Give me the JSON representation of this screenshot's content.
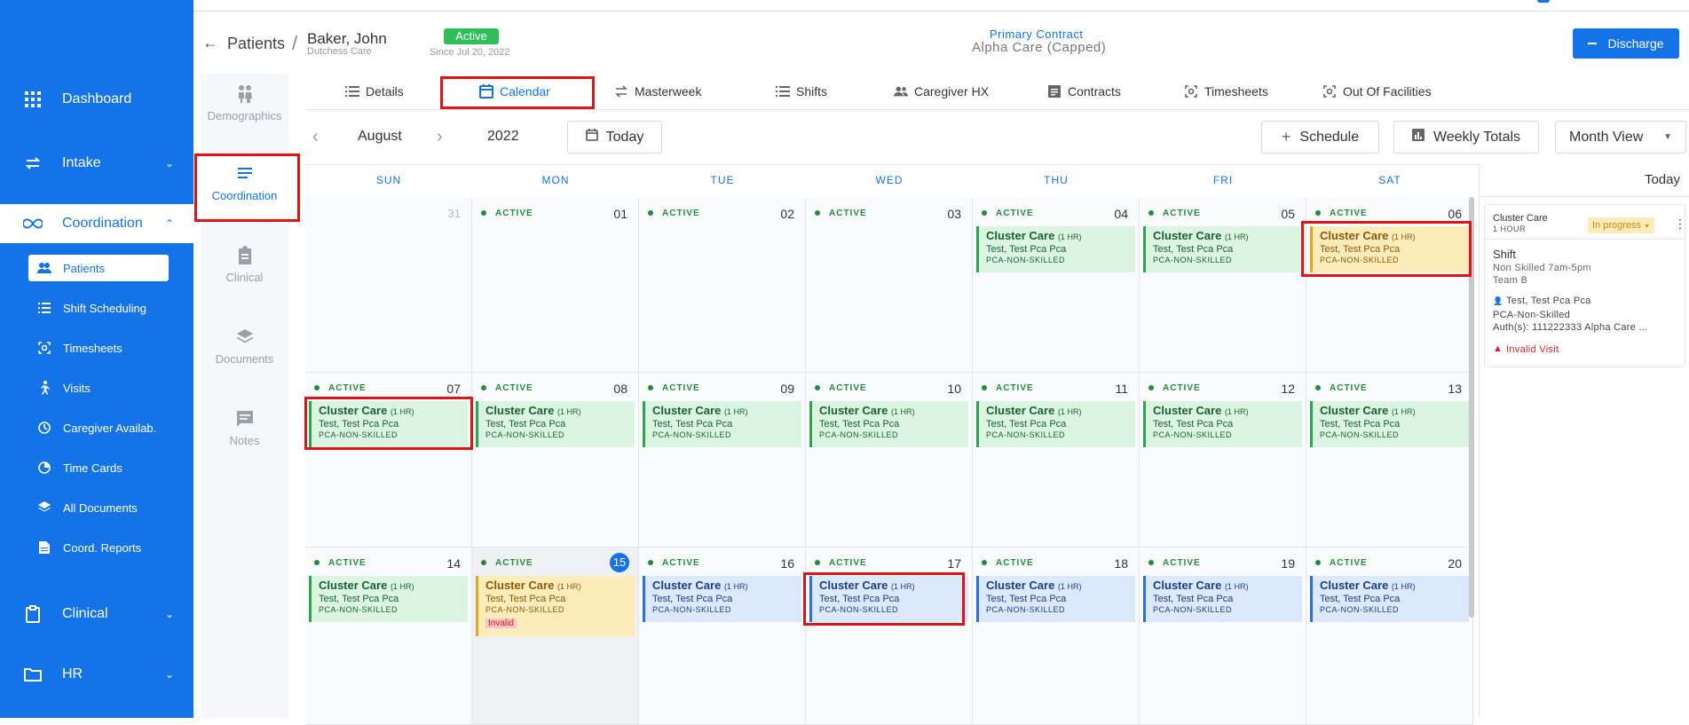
{
  "sidebar": {
    "dashboard": "Dashboard",
    "intake": "Intake",
    "coordination": "Coordination",
    "sub": [
      "Patients",
      "Shift Scheduling",
      "Timesheets",
      "Visits",
      "Caregiver Availab.",
      "Time Cards",
      "All Documents",
      "Coord. Reports"
    ],
    "clinical": "Clinical",
    "hr": "HR"
  },
  "header": {
    "breadcrumb_root": "Patients",
    "separator": "/",
    "patient_name": "Baker, John",
    "patient_sub": "Dutchess Care",
    "status": "Active",
    "since": "Since Jul 20, 2022",
    "contract_label": "Primary Contract",
    "contract_value": "Alpha Care (Capped)",
    "discharge": "Discharge"
  },
  "left_tabs": [
    "Demographics",
    "Coordination",
    "Clinical",
    "Documents",
    "Notes"
  ],
  "tabs": [
    "Details",
    "Calendar",
    "Masterweek",
    "Shifts",
    "Caregiver HX",
    "Contracts",
    "Timesheets",
    "Out Of Facilities"
  ],
  "toolbar": {
    "month": "August",
    "year": "2022",
    "today": "Today",
    "schedule": "Schedule",
    "weekly_totals": "Weekly Totals",
    "view": "Month View"
  },
  "days": [
    "SUN",
    "MON",
    "TUE",
    "WED",
    "THU",
    "FRI",
    "SAT"
  ],
  "status_label": "ACTIVE",
  "event": {
    "title": "Cluster Care",
    "dur": "(1 HR)",
    "person": "Test, Test Pca Pca",
    "role": "PCA-NON-SKILLED",
    "invalid": "Invalid"
  },
  "weeks": [
    [
      {
        "d": "31",
        "muted": true
      },
      {
        "d": "01",
        "s": true
      },
      {
        "d": "02",
        "s": true
      },
      {
        "d": "03",
        "s": true
      },
      {
        "d": "04",
        "s": true,
        "e": "g"
      },
      {
        "d": "05",
        "s": true,
        "e": "g"
      },
      {
        "d": "06",
        "s": true,
        "e": "y"
      }
    ],
    [
      {
        "d": "07",
        "s": true,
        "e": "g"
      },
      {
        "d": "08",
        "s": true,
        "e": "g"
      },
      {
        "d": "09",
        "s": true,
        "e": "g"
      },
      {
        "d": "10",
        "s": true,
        "e": "g"
      },
      {
        "d": "11",
        "s": true,
        "e": "g"
      },
      {
        "d": "12",
        "s": true,
        "e": "g"
      },
      {
        "d": "13",
        "s": true,
        "e": "g"
      }
    ],
    [
      {
        "d": "14",
        "s": true,
        "e": "g"
      },
      {
        "d": "15",
        "s": true,
        "e": "y",
        "today": true,
        "inv": true
      },
      {
        "d": "16",
        "s": true,
        "e": "b"
      },
      {
        "d": "17",
        "s": true,
        "e": "b"
      },
      {
        "d": "18",
        "s": true,
        "e": "b"
      },
      {
        "d": "19",
        "s": true,
        "e": "b"
      },
      {
        "d": "20",
        "s": true,
        "e": "b"
      }
    ]
  ],
  "panel": {
    "title": "Today",
    "card_title": "Cluster Care",
    "card_dur": "1 HOUR",
    "badge": "In progress",
    "shift": "Shift",
    "shift_detail": "Non Skilled 7am-5pm",
    "team": "Team B",
    "caregiver": "Test, Test Pca Pca",
    "role": "PCA-Non-Skilled",
    "auth": "Auth(s): 111222333 Alpha Care ...",
    "invalid": "Invalid Visit"
  },
  "colors": {
    "brand": "#1473e6",
    "active_green": "#2fa44f",
    "highlight_red": "#e01414"
  }
}
